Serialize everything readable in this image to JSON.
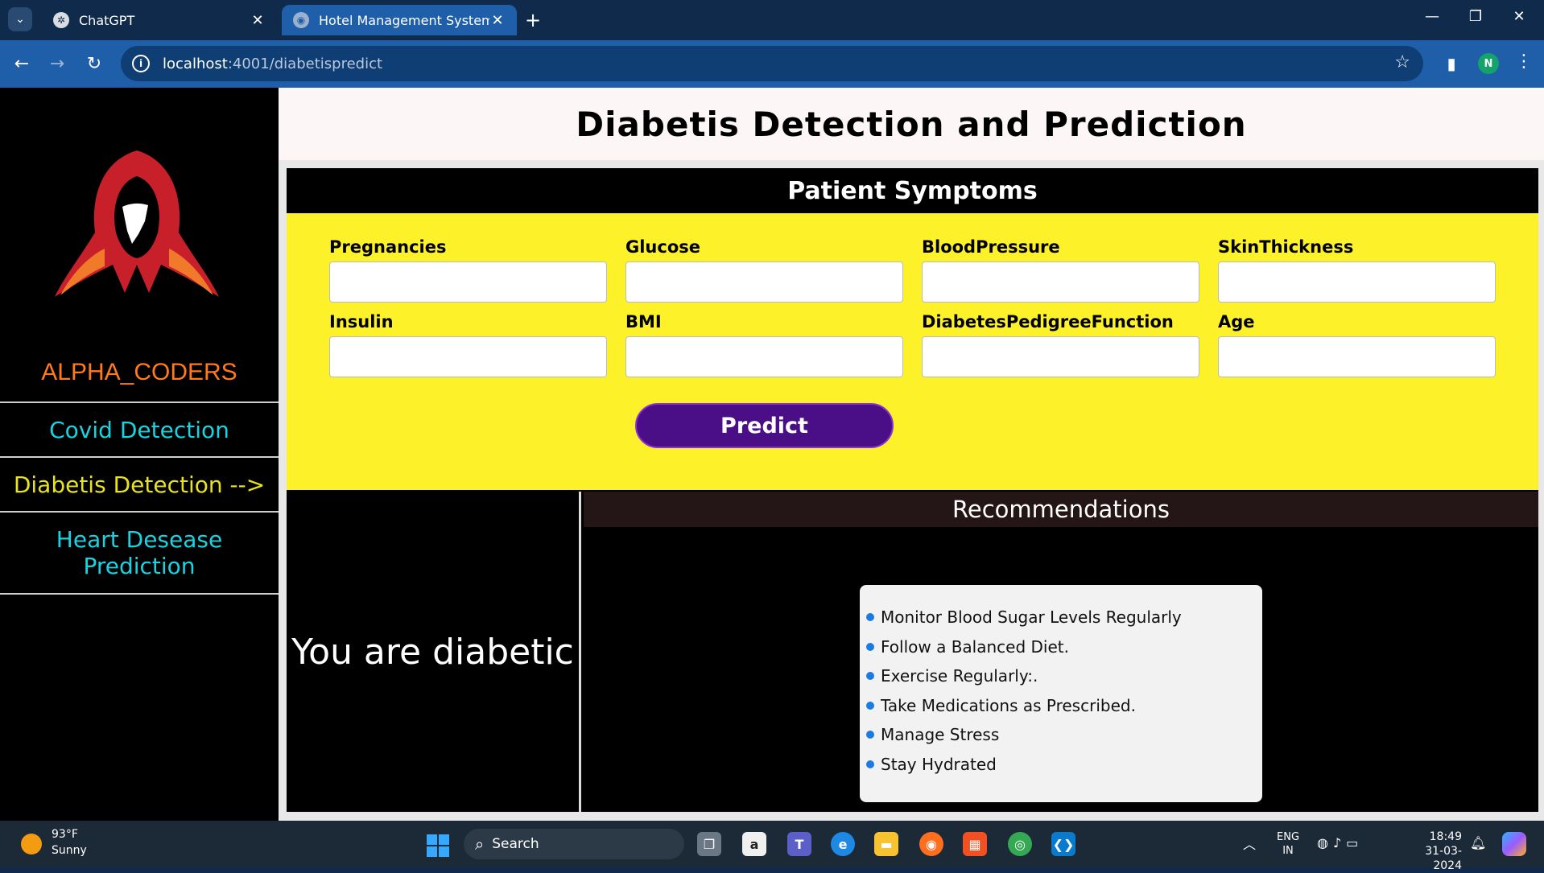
{
  "browser": {
    "tabs": [
      {
        "title": "ChatGPT",
        "active": false
      },
      {
        "title": "Hotel Management System",
        "active": true
      }
    ],
    "url_host": "localhost",
    "url_rest": ":4001/diabetispredict",
    "profile_initial": "N"
  },
  "sidebar": {
    "brand": "ALPHA_CODERS",
    "items": [
      {
        "label": "Covid Detection"
      },
      {
        "label": "Diabetis Detection -->"
      },
      {
        "label": "Heart Desease Prediction"
      }
    ]
  },
  "header": {
    "title": "Diabetis Detection and Prediction"
  },
  "form": {
    "title": "Patient Symptoms",
    "fields": [
      {
        "label": "Pregnancies",
        "value": ""
      },
      {
        "label": "Glucose",
        "value": ""
      },
      {
        "label": "BloodPressure",
        "value": ""
      },
      {
        "label": "SkinThickness",
        "value": ""
      },
      {
        "label": "Insulin",
        "value": ""
      },
      {
        "label": "BMI",
        "value": ""
      },
      {
        "label": "DiabetesPedigreeFunction",
        "value": ""
      },
      {
        "label": "Age",
        "value": ""
      }
    ],
    "predict_label": "Predict"
  },
  "result": {
    "text": "You are diabetic",
    "recommendations_title": "Recommendations",
    "recommendations": [
      "Monitor Blood Sugar Levels Regularly",
      "Follow a Balanced Diet.",
      "Exercise Regularly:.",
      "Take Medications as Prescribed.",
      "Manage Stress",
      "Stay Hydrated"
    ]
  },
  "taskbar": {
    "weather_temp": "93°F",
    "weather_desc": "Sunny",
    "search_label": "Search",
    "lang_line1": "ENG",
    "lang_line2": "IN",
    "time": "18:49",
    "date": "31-03-2024"
  },
  "colors": {
    "brand": "#ff7a1a",
    "nav_link": "#19d3e0",
    "nav_active": "#e8e31a",
    "form_bg": "#fdf22a",
    "predict_bg": "#4a0f87",
    "bullet": "#1a7be0"
  }
}
